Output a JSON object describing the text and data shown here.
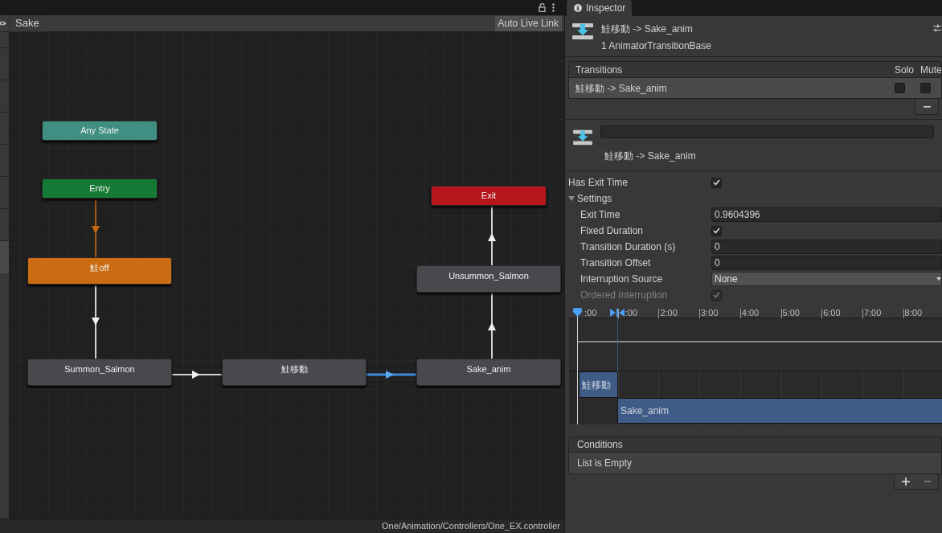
{
  "graph_window": {
    "breadcrumb": "Sake",
    "auto_live_link": "Auto Live Link",
    "status_path": "One/Animation/Controllers/One_EX.controller",
    "states": [
      {
        "label": "Any State",
        "kind": "any",
        "selected": false
      },
      {
        "label": "Entry",
        "kind": "entry",
        "selected": false
      },
      {
        "label": "Exit",
        "kind": "exit",
        "selected": false
      },
      {
        "label": "鮭off",
        "kind": "default",
        "selected": false
      },
      {
        "label": "Unsummon_Salmon",
        "kind": "normal",
        "selected": false
      },
      {
        "label": "Summon_Salmon",
        "kind": "normal",
        "selected": false
      },
      {
        "label": "鮭移動",
        "kind": "normal",
        "selected": false
      },
      {
        "label": "Sake_anim",
        "kind": "normal",
        "selected": false
      }
    ],
    "transitions": [
      {
        "kind": "entry",
        "selected": false
      },
      {
        "kind": "normal",
        "selected": false
      },
      {
        "kind": "normal",
        "selected": false
      },
      {
        "kind": "normal",
        "selected": true
      },
      {
        "kind": "normal",
        "selected": false
      },
      {
        "kind": "normal",
        "selected": false
      }
    ]
  },
  "inspector": {
    "tab": "Inspector",
    "title": "鮭移動 -> Sake_anim",
    "subtitle": "1 AnimatorTransitionBase",
    "transitions_list": {
      "header": "Transitions",
      "solo_label": "Solo",
      "mute_label": "Mute",
      "rows": [
        {
          "label": "鮭移動 -> Sake_anim",
          "solo": false,
          "mute": false,
          "selected": true
        }
      ]
    },
    "transition_name": "鮭移動 -> Sake_anim",
    "has_exit_time": {
      "label": "Has Exit Time",
      "checked": true
    },
    "settings": {
      "label": "Settings",
      "expanded": true,
      "fields": [
        {
          "kind": "text",
          "label": "Exit Time",
          "value": "0.9604396"
        },
        {
          "kind": "checkbox",
          "label": "Fixed Duration",
          "checked": true,
          "disabled": false
        },
        {
          "kind": "text",
          "label": "Transition Duration (s)",
          "value": "0"
        },
        {
          "kind": "text",
          "label": "Transition Offset",
          "value": "0"
        },
        {
          "kind": "dropdown",
          "label": "Interruption Source",
          "value": "None"
        },
        {
          "kind": "checkbox",
          "label": "Ordered Interruption",
          "checked": true,
          "disabled": true
        }
      ]
    },
    "timeline": {
      "ticks": [
        ":00",
        ":00",
        "2:00",
        "3:00",
        "4:00",
        "5:00",
        "6:00",
        "7:00",
        "8:00"
      ],
      "clips": [
        {
          "label": "鮭移動"
        },
        {
          "label": "Sake_anim"
        }
      ]
    },
    "conditions": {
      "header": "Conditions",
      "empty_text": "List is Empty"
    }
  }
}
